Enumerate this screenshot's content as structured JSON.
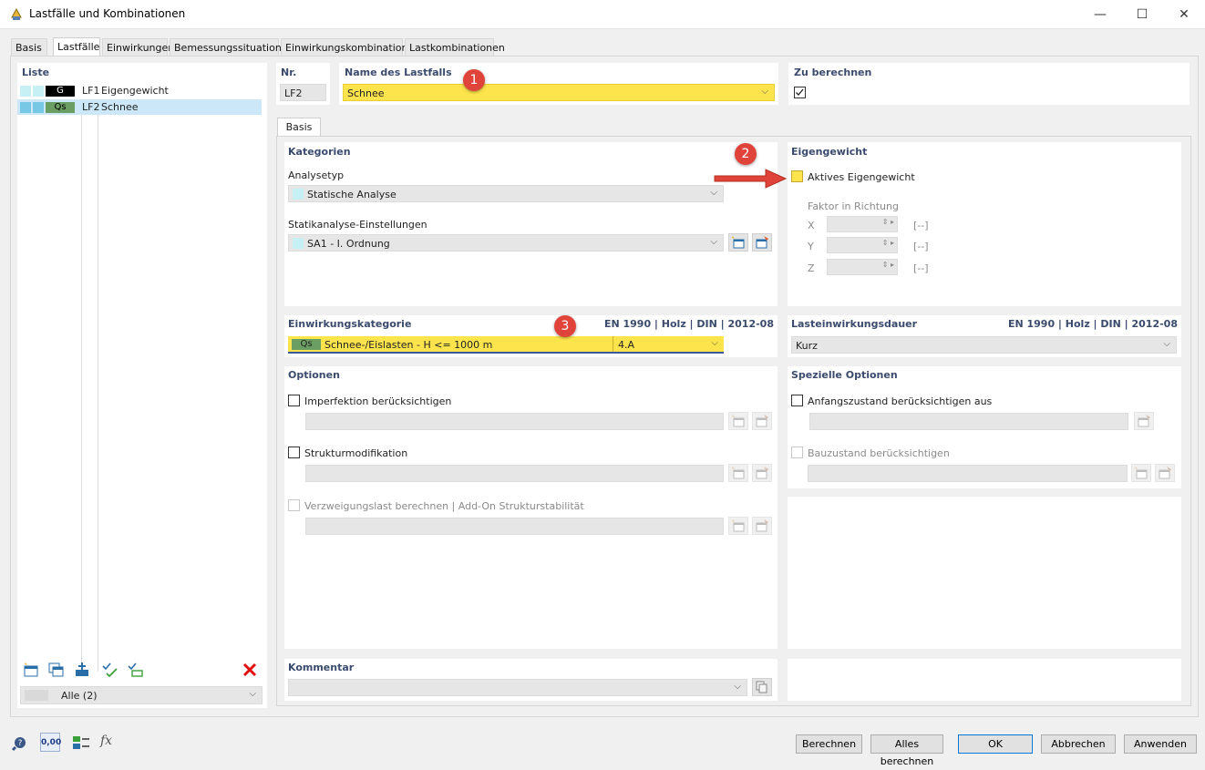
{
  "window": {
    "title": "Lastfälle und Kombinationen",
    "minimize": "—",
    "maximize": "☐",
    "close": "✕"
  },
  "tabs": [
    "Basis",
    "Lastfälle",
    "Einwirkungen",
    "Bemessungssituationen",
    "Einwirkungskombinationen",
    "Lastkombinationen"
  ],
  "list": {
    "header": "Liste",
    "items": [
      {
        "code": "G",
        "id": "LF1",
        "name": "Eigengewicht"
      },
      {
        "code": "Qs",
        "id": "LF2",
        "name": "Schnee"
      }
    ],
    "filter": "Alle (2)"
  },
  "nr": {
    "label": "Nr.",
    "value": "LF2"
  },
  "name": {
    "label": "Name des Lastfalls",
    "value": "Schnee"
  },
  "calc": {
    "label": "Zu berechnen"
  },
  "inner_tab": "Basis",
  "kategorien": {
    "header": "Kategorien",
    "analysetyp_label": "Analysetyp",
    "analysetyp": "Statische Analyse",
    "statik_label": "Statikanalyse-Einstellungen",
    "statik": "SA1 - I. Ordnung"
  },
  "eigengewicht": {
    "header": "Eigengewicht",
    "aktiv": "Aktives Eigengewicht",
    "faktor": "Faktor in Richtung",
    "axes": [
      "X",
      "Y",
      "Z"
    ],
    "unit": "[--]"
  },
  "einwirkung": {
    "header": "Einwirkungskategorie",
    "norm": "EN 1990 | Holz | DIN | 2012-08",
    "code": "Qs",
    "value": "Schnee-/Eislasten - H <= 1000 m",
    "sub": "4.A"
  },
  "dauer": {
    "header": "Lasteinwirkungsdauer",
    "norm": "EN 1990 | Holz | DIN | 2012-08",
    "value": "Kurz"
  },
  "optionen": {
    "header": "Optionen",
    "imperfektion": "Imperfektion berücksichtigen",
    "struktur": "Strukturmodifikation",
    "verzweigung": "Verzweigungslast berechnen | Add-On Strukturstabilität"
  },
  "spezielle": {
    "header": "Spezielle Optionen",
    "anfang": "Anfangszustand berücksichtigen aus",
    "bau": "Bauzustand berücksichtigen"
  },
  "kommentar": {
    "header": "Kommentar"
  },
  "markers": [
    "1",
    "2",
    "3"
  ],
  "buttons": {
    "berechnen": "Berechnen",
    "alles": "Alles berechnen",
    "ok": "OK",
    "abbrechen": "Abbrechen",
    "anwenden": "Anwenden"
  },
  "bottom_icon_label": "0,00",
  "colors": {
    "yellow": "#fde44d",
    "accent": "#0078d7",
    "marker": "#e0433a",
    "green": "#6b9e62"
  }
}
